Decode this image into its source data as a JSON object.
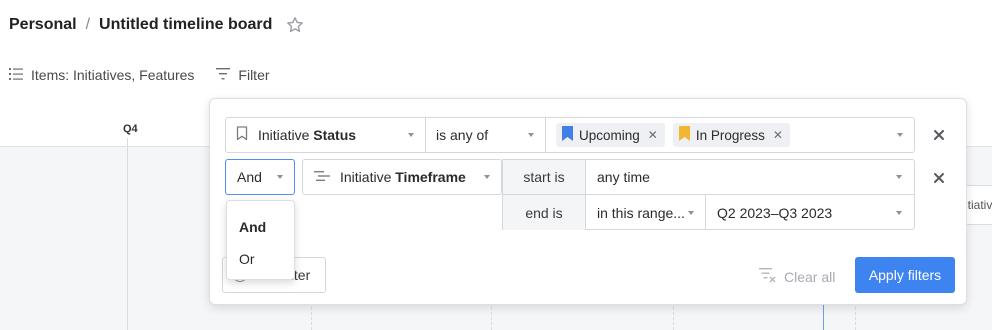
{
  "breadcrumb": {
    "workspace": "Personal",
    "separator": "/",
    "board": "Untitled timeline board"
  },
  "toolbar": {
    "items_label": "Items: Initiatives, Features",
    "filter_label": "Filter"
  },
  "timeline": {
    "quarter_label": "Q4",
    "card_text": "Initiativ"
  },
  "filter_panel": {
    "condition1": {
      "field_prefix": "Initiative",
      "field_name": "Status",
      "operator": "is any of",
      "values": [
        {
          "label": "Upcoming",
          "color": "#3f7fe6",
          "icon": "bookmark-flag-icon"
        },
        {
          "label": "In Progress",
          "color": "#f2b633",
          "icon": "bookmark-flag-icon"
        }
      ]
    },
    "conjunction": {
      "value": "And",
      "options": [
        "And",
        "Or"
      ]
    },
    "condition2": {
      "field_prefix": "Initiative",
      "field_name": "Timeframe",
      "start_label": "start is",
      "start_value": "any time",
      "end_label": "end is",
      "end_operator": "in this range...",
      "end_value": "Q2 2023–Q3 2023"
    },
    "add_filter_label": "Add filter",
    "clear_all_label": "Clear all",
    "apply_label": "Apply filters"
  },
  "colors": {
    "accent": "#3d84f0",
    "upcoming": "#3f7fe6",
    "in_progress": "#f2b633"
  }
}
